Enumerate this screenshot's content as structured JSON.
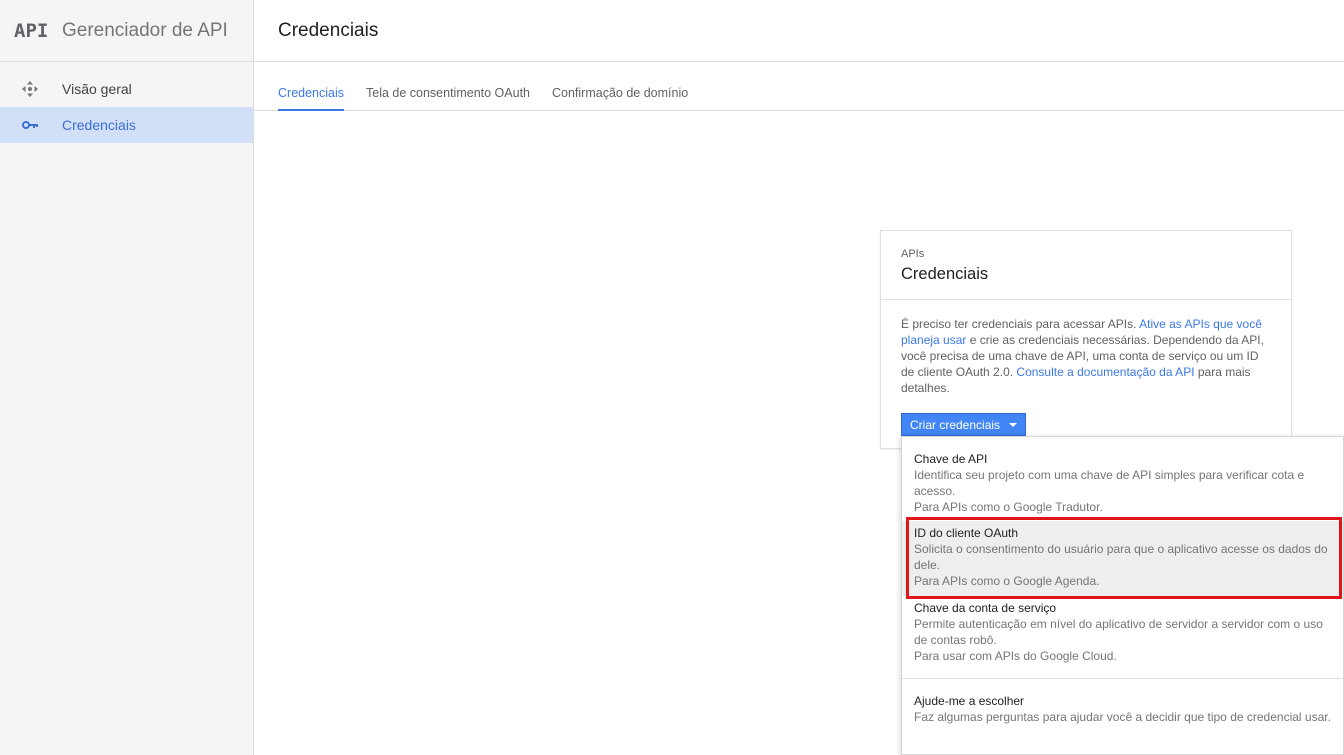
{
  "brand": {
    "logo_text": "API",
    "title": "Gerenciador de API"
  },
  "sidebar": {
    "items": [
      {
        "label": "Visão geral",
        "icon": "move-arrows-icon",
        "active": false
      },
      {
        "label": "Credenciais",
        "icon": "key-icon",
        "active": true
      }
    ]
  },
  "header": {
    "title": "Credenciais"
  },
  "tabs": [
    {
      "label": "Credenciais",
      "active": true
    },
    {
      "label": "Tela de consentimento OAuth",
      "active": false
    },
    {
      "label": "Confirmação de domínio",
      "active": false
    }
  ],
  "card": {
    "subtitle": "APIs",
    "title": "Credenciais",
    "body": {
      "text1": "É preciso ter credenciais para acessar APIs. ",
      "link1": "Ative as APIs que você planeja usar",
      "text2": " e crie as credenciais necessárias. Dependendo da API, você precisa de uma chave de API, uma conta de serviço ou um ID de cliente OAuth 2.0. ",
      "link2": "Consulte a documentação da API",
      "text3": " para mais detalhes."
    },
    "button_label": "Criar credenciais"
  },
  "dropdown": {
    "items": [
      {
        "title": "Chave de API",
        "desc1": "Identifica seu projeto com uma chave de API simples para verificar cota e acesso.",
        "desc2": "Para APIs como o Google Tradutor."
      },
      {
        "title": "ID do cliente OAuth",
        "desc1": "Solicita o consentimento do usuário para que o aplicativo acesse os dados do dele.",
        "desc2": "Para APIs como o Google Agenda."
      },
      {
        "title": "Chave da conta de serviço",
        "desc1": "Permite autenticação em nível do aplicativo de servidor a servidor com o uso de contas robô.",
        "desc2": "Para usar com APIs do Google Cloud."
      },
      {
        "title": "Ajude-me a escolher",
        "desc1": "Faz algumas perguntas para ajudar você a decidir que tipo de credencial usar."
      }
    ]
  },
  "colors": {
    "accent": "#3b78e7",
    "button": "#4285f4",
    "active_nav_bg": "#d2e0f7",
    "highlight": "#e3141b"
  }
}
